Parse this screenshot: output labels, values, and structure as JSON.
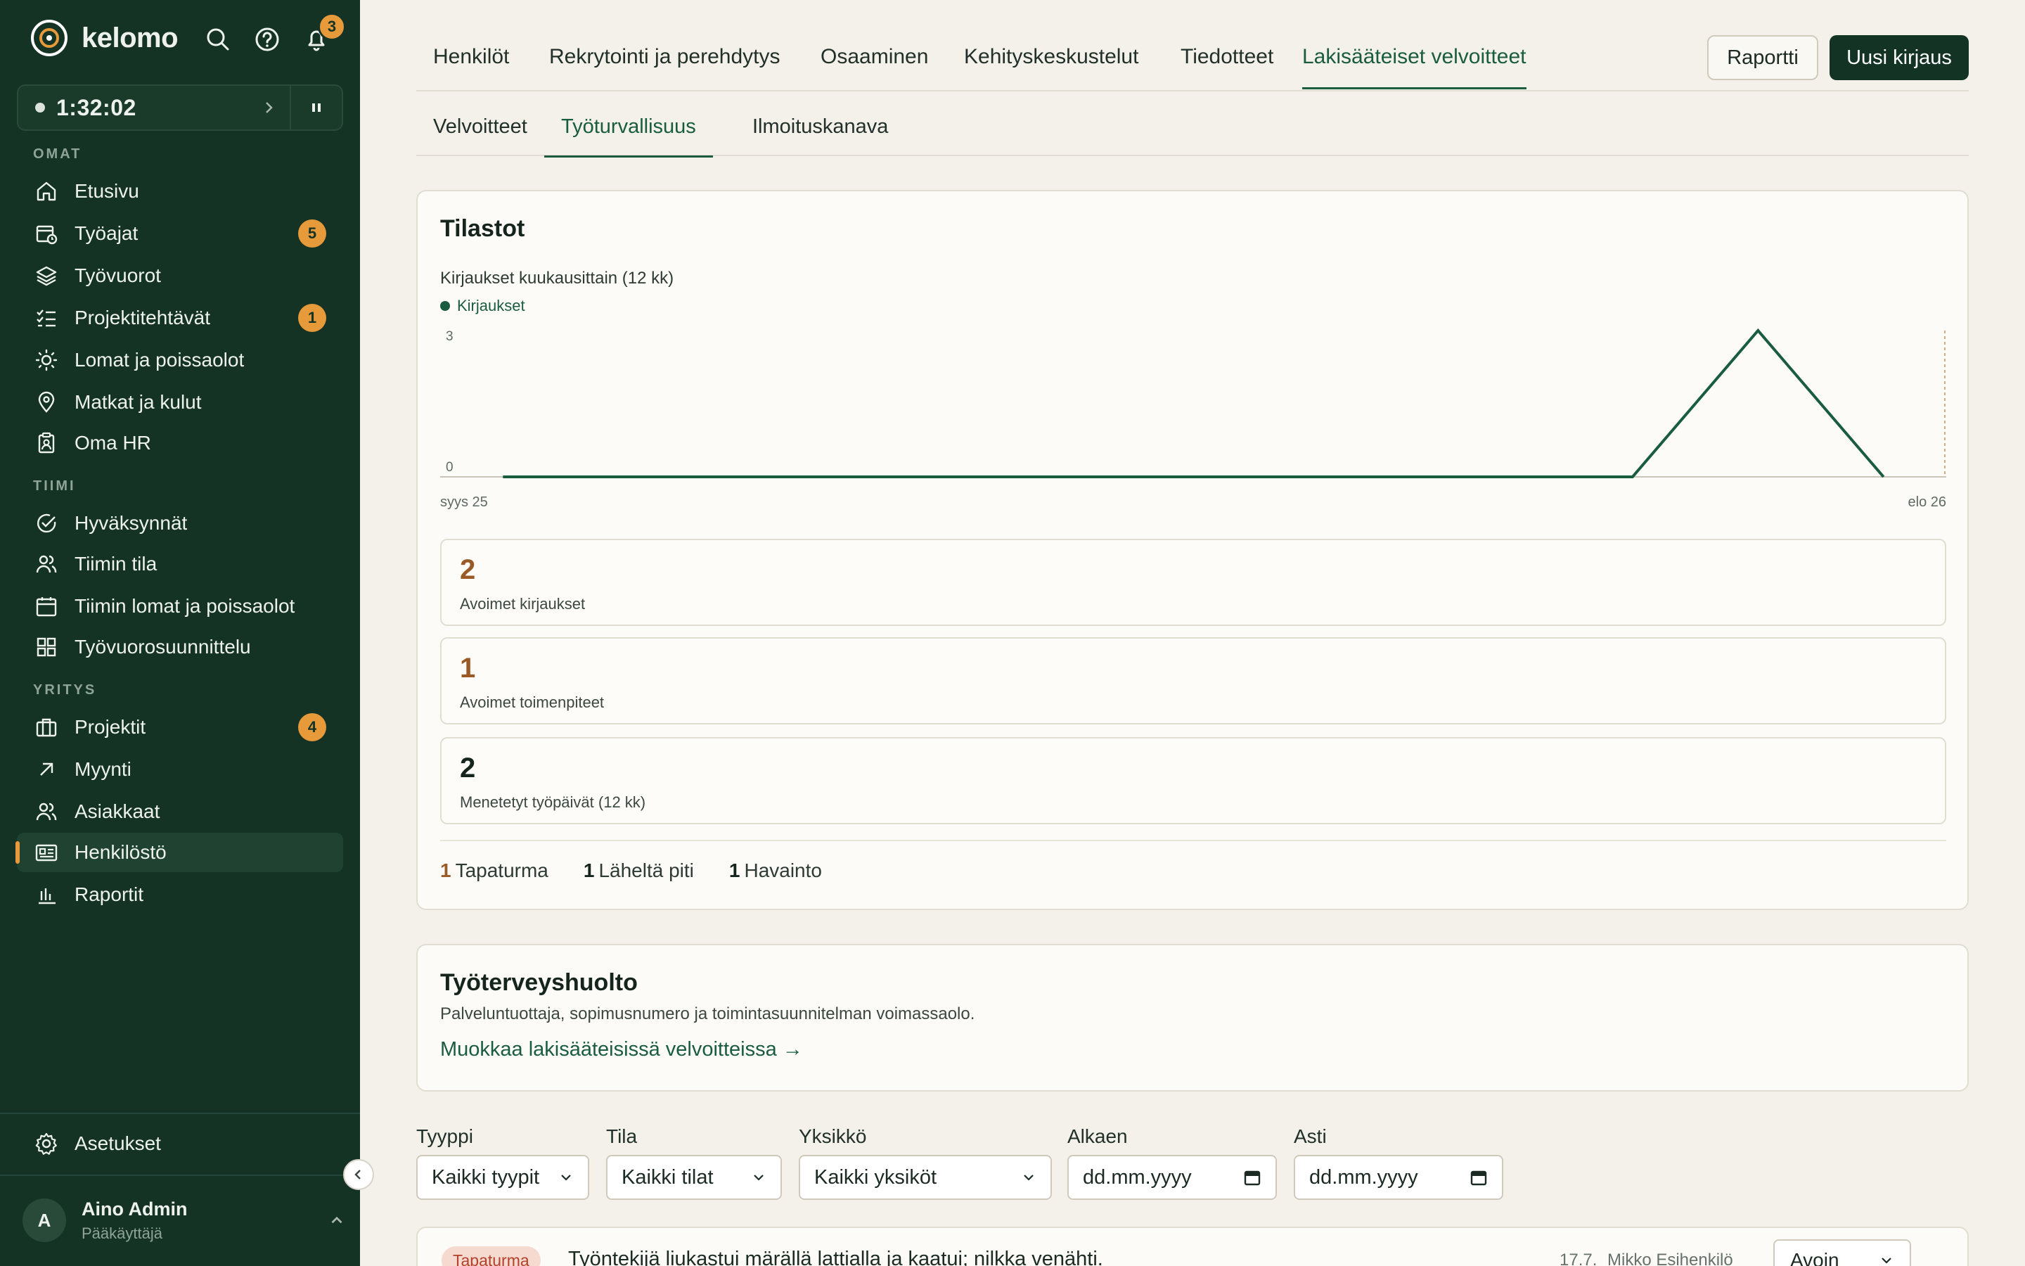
{
  "app": {
    "name": "kelomo",
    "notification_count": "3"
  },
  "timer": {
    "time": "1:32:02"
  },
  "sidebar": {
    "sections": [
      {
        "title": "OMAT",
        "items": [
          {
            "label": "Etusivu",
            "icon": "home-icon",
            "badge": ""
          },
          {
            "label": "Työajat",
            "icon": "calendar-clock-icon",
            "badge": "5"
          },
          {
            "label": "Työvuorot",
            "icon": "layers-icon",
            "badge": ""
          },
          {
            "label": "Projektitehtävät",
            "icon": "checklist-icon",
            "badge": "1"
          },
          {
            "label": "Lomat ja poissaolot",
            "icon": "sun-icon",
            "badge": ""
          },
          {
            "label": "Matkat ja kulut",
            "icon": "map-pin-icon",
            "badge": ""
          },
          {
            "label": "Oma HR",
            "icon": "clipboard-user-icon",
            "badge": ""
          }
        ]
      },
      {
        "title": "TIIMI",
        "items": [
          {
            "label": "Hyväksynnät",
            "icon": "check-circle-icon",
            "badge": ""
          },
          {
            "label": "Tiimin tila",
            "icon": "users-icon",
            "badge": ""
          },
          {
            "label": "Tiimin lomat ja poissaolot",
            "icon": "calendar-icon",
            "badge": ""
          },
          {
            "label": "Työvuorosuunnittelu",
            "icon": "grid-icon",
            "badge": ""
          }
        ]
      },
      {
        "title": "YRITYS",
        "items": [
          {
            "label": "Projektit",
            "icon": "briefcase-icon",
            "badge": "4"
          },
          {
            "label": "Myynti",
            "icon": "arrow-up-right-icon",
            "badge": ""
          },
          {
            "label": "Asiakkaat",
            "icon": "users-icon",
            "badge": ""
          },
          {
            "label": "Henkilöstö",
            "icon": "id-card-icon",
            "badge": "",
            "active": true
          },
          {
            "label": "Raportit",
            "icon": "bar-chart-icon",
            "badge": ""
          }
        ]
      }
    ],
    "settings": "Asetukset",
    "user": {
      "initial": "A",
      "name": "Aino Admin",
      "role": "Pääkäyttäjä"
    }
  },
  "tabs": [
    "Henkilöt",
    "Rekrytointi ja perehdytys",
    "Osaaminen",
    "Kehityskeskustelut",
    "Tiedotteet",
    "Lakisääteiset velvoitteet"
  ],
  "active_tab": "Lakisääteiset velvoitteet",
  "buttons": {
    "report": "Raportti",
    "new_entry": "Uusi kirjaus"
  },
  "subtabs": [
    "Velvoitteet",
    "Työturvallisuus",
    "Ilmoituskanava"
  ],
  "active_subtab": "Työturvallisuus",
  "stats": {
    "title": "Tilastot",
    "caption": "Kirjaukset kuukausittain (12 kk)",
    "boxes": [
      {
        "value": "2",
        "label": "Avoimet kirjaukset",
        "color": "#9a5a26"
      },
      {
        "value": "1",
        "label": "Avoimet toimenpiteet",
        "color": "#9a5a26"
      },
      {
        "value": "2",
        "label": "Menetetyt työpäivät (12 kk)",
        "color": "#15241c"
      }
    ],
    "counts": [
      {
        "num": "1",
        "label": "Tapaturma",
        "color": "#9a5a26"
      },
      {
        "num": "1",
        "label": "Läheltä piti",
        "color": "#15241c"
      },
      {
        "num": "1",
        "label": "Havainto",
        "color": "#15241c"
      }
    ]
  },
  "chart_data": {
    "type": "line",
    "title": "",
    "series": [
      {
        "name": "Kirjaukset",
        "values": [
          0,
          0,
          0,
          0,
          0,
          0,
          0,
          0,
          0,
          0,
          3,
          0
        ]
      }
    ],
    "x_start_label": "syys 25",
    "x_end_label": "elo 26",
    "y_ticks": [
      "0",
      "3"
    ],
    "ylim": [
      0,
      3
    ],
    "color": "#1a5c40"
  },
  "occupational_health": {
    "title": "Työterveyshuolto",
    "description": "Palveluntuottaja, sopimusnumero ja toimintasuunnitelman voimassaolo.",
    "link": "Muokkaa lakisääteisissä velvoitteissa →"
  },
  "filters": [
    {
      "label": "Tyyppi",
      "value": "Kaikki tyypit",
      "kind": "select"
    },
    {
      "label": "Tila",
      "value": "Kaikki tilat",
      "kind": "select"
    },
    {
      "label": "Yksikkö",
      "value": "Kaikki yksiköt",
      "kind": "select"
    },
    {
      "label": "Alkaen",
      "value": "dd.mm.yyyy",
      "kind": "date"
    },
    {
      "label": "Asti",
      "value": "dd.mm.yyyy",
      "kind": "date"
    }
  ],
  "entries": [
    {
      "type": "Tapaturma",
      "title": "Työntekijä liukastui märällä lattialla ja kaatui; nilkka venähti.",
      "date": "17.7.",
      "person": "Mikko Esihenkilö",
      "status": "Avoin"
    }
  ]
}
